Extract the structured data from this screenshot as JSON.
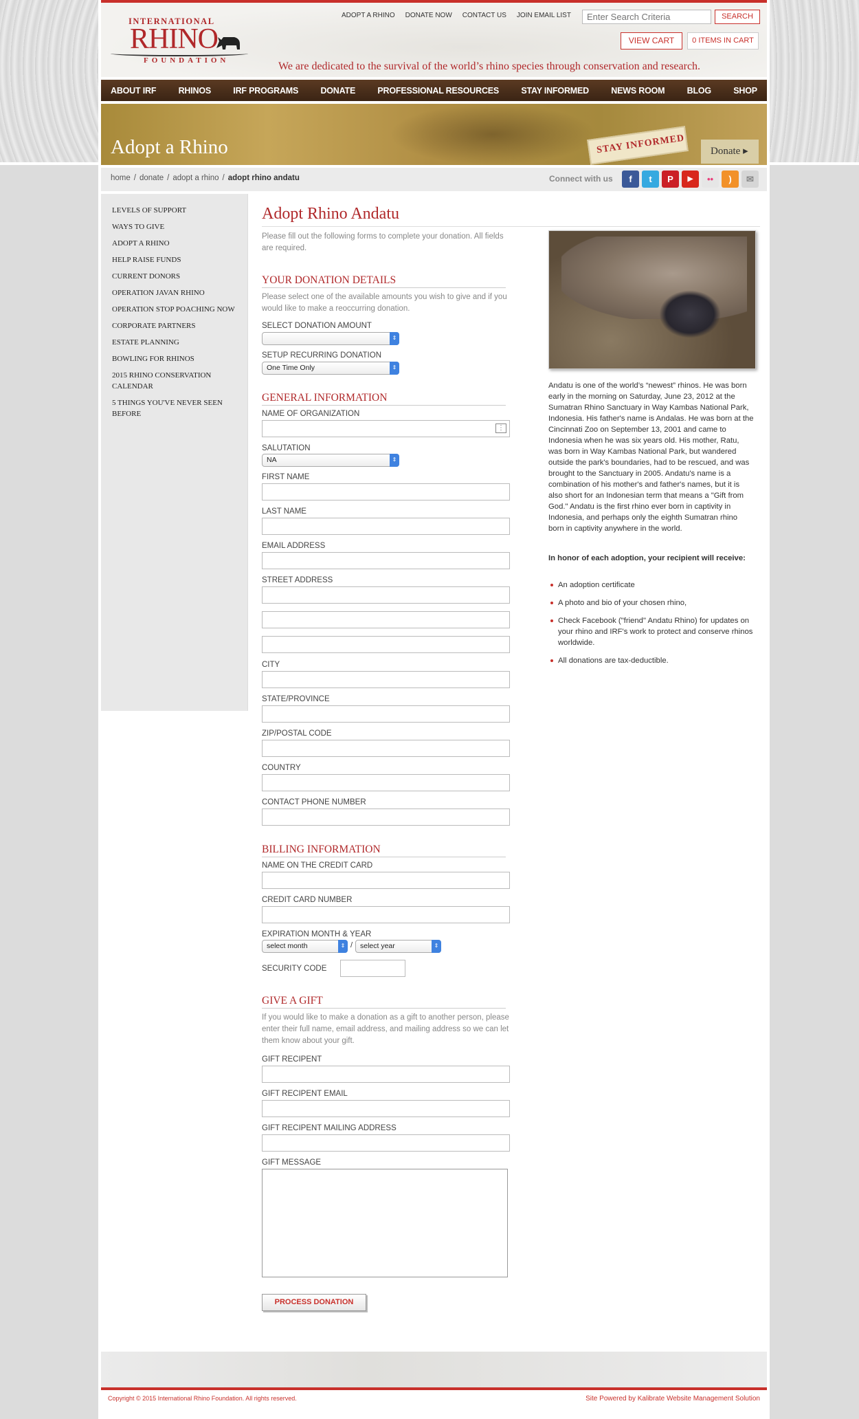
{
  "header": {
    "logo": {
      "line1": "INTERNATIONAL",
      "line2": "RHINO",
      "line3": "FOUNDATION"
    },
    "top_links": [
      "ADOPT A RHINO",
      "DONATE NOW",
      "CONTACT US",
      "JOIN EMAIL LIST"
    ],
    "search": {
      "placeholder": "Enter Search Criteria",
      "button": "SEARCH"
    },
    "view_cart": "VIEW CART",
    "items_in_cart": "0 ITEMS IN CART",
    "tagline": "We are dedicated to the survival of the world’s rhino species through conservation and research."
  },
  "nav": [
    "ABOUT IRF",
    "RHINOS",
    "IRF PROGRAMS",
    "DONATE",
    "PROFESSIONAL RESOURCES",
    "STAY INFORMED",
    "NEWS ROOM",
    "BLOG",
    "SHOP"
  ],
  "banner": {
    "title": "Adopt a Rhino",
    "stay_informed": "STAY INFORMED",
    "donate": "Donate ▸"
  },
  "breadcrumb": {
    "items": [
      "home",
      "donate",
      "adopt a rhino"
    ],
    "current": "adopt rhino andatu",
    "separator": "/"
  },
  "connect": {
    "label": "Connect with us",
    "icons": [
      {
        "name": "facebook-icon",
        "glyph": "f",
        "color": "#3b5998"
      },
      {
        "name": "twitter-icon",
        "glyph": "t",
        "color": "#35a9e0"
      },
      {
        "name": "pinterest-icon",
        "glyph": "P",
        "color": "#cb2027"
      },
      {
        "name": "youtube-icon",
        "glyph": "▶",
        "color": "#d8281d"
      },
      {
        "name": "flickr-icon",
        "glyph": "••",
        "color": "#e6e6e6"
      },
      {
        "name": "rss-icon",
        "glyph": ")",
        "color": "#f29129"
      },
      {
        "name": "email-icon",
        "glyph": "✉",
        "color": "#d6d6d6"
      }
    ]
  },
  "sidebar": [
    "LEVELS OF SUPPORT",
    "WAYS TO GIVE",
    "ADOPT A RHINO",
    "HELP RAISE FUNDS",
    "CURRENT DONORS",
    "OPERATION JAVAN RHINO",
    "OPERATION STOP POACHING NOW",
    "CORPORATE PARTNERS",
    "ESTATE PLANNING",
    "BOWLING FOR RHINOS",
    "2015 RHINO CONSERVATION CALENDAR",
    "5 THINGS YOU'VE NEVER SEEN BEFORE"
  ],
  "main": {
    "title": "Adopt Rhino Andatu",
    "intro": "Please fill out the following forms to complete your donation. All fields are required.",
    "donation": {
      "heading": "YOUR DONATION DETAILS",
      "desc": "Please select one of the available amounts you wish to give and if you would like to make a reoccurring donation.",
      "amount_label": "SELECT DONATION AMOUNT",
      "amount_value": "",
      "recurring_label": "SETUP RECURRING DONATION",
      "recurring_value": "One Time Only"
    },
    "general": {
      "heading": "GENERAL INFORMATION",
      "organization": "NAME OF ORGANIZATION",
      "salutation_label": "SALUTATION",
      "salutation_value": "NA",
      "first_name": "FIRST NAME",
      "last_name": "LAST NAME",
      "email": "EMAIL ADDRESS",
      "street": "STREET ADDRESS",
      "city": "CITY",
      "state": "STATE/PROVINCE",
      "zip": "ZIP/POSTAL CODE",
      "country": "COUNTRY",
      "phone": "CONTACT PHONE NUMBER"
    },
    "billing": {
      "heading": "BILLING INFORMATION",
      "name_on_card": "NAME ON THE CREDIT CARD",
      "card_number": "CREDIT CARD NUMBER",
      "expiration": "EXPIRATION MONTH & YEAR",
      "month_value": "select month",
      "year_value": "select year",
      "slash": "/",
      "security": "SECURITY CODE"
    },
    "gift": {
      "heading": "GIVE A GIFT",
      "desc": "If you would like to make a donation as a gift to another person, please enter their full name, email address, and mailing address so we can let them know about your gift.",
      "recipient": "GIFT RECIPENT",
      "recipient_email": "GIFT RECIPENT EMAIL",
      "recipient_address": "GIFT RECIPENT MAILING ADDRESS",
      "message": "GIFT MESSAGE"
    },
    "process_button": "PROCESS DONATION"
  },
  "aside": {
    "bio": "Andatu is one of the world’s “newest” rhinos. He was born early in the morning on Saturday, June 23, 2012 at the Sumatran Rhino Sanctuary in Way Kambas National Park, Indonesia. His father's name is Andalas. He was born at the Cincinnati Zoo on September 13, 2001 and came to Indonesia when he was six years old. His mother, Ratu, was born in Way Kambas National Park, but wandered outside the park's boundaries, had to be rescued, and was brought to the Sanctuary in 2005. Andatu's name is a combination of his mother's and father's names, but it is also short for an Indonesian term that means a \"Gift from God.\" Andatu is the first rhino ever born in captivity in Indonesia, and perhaps only the eighth Sumatran rhino born in captivity anywhere in the world.",
    "honor": "In honor of each adoption, your recipient will receive:",
    "bullets": [
      "An adoption certificate",
      "A photo and bio of your chosen rhino,",
      "Check Facebook (\"friend\" Andatu Rhino) for updates on your rhino and IRF's work to protect and conserve rhinos worldwide.",
      "All donations are tax-deductible."
    ]
  },
  "footer": {
    "copyright": "Copyright © 2015 International Rhino Foundation. All rights reserved.",
    "powered": "Site Powered by Kalibrate Website Management Solution"
  },
  "colors": {
    "accent": "#c8302b",
    "nav": "#4a2e1a",
    "sidebar": "#e8e8e8"
  }
}
